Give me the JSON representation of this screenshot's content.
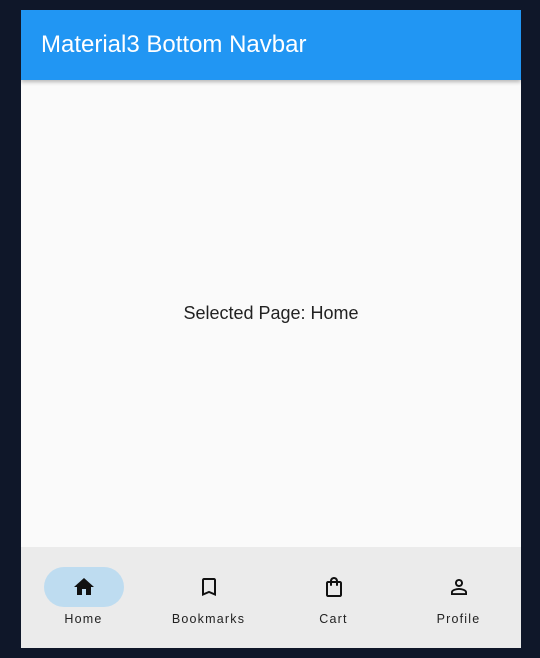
{
  "app_bar": {
    "title": "Material3 Bottom Navbar",
    "color": "#2196f3"
  },
  "body": {
    "selected_page_text": "Selected Page: Home"
  },
  "bottom_nav": {
    "selected_index": 0,
    "indicator_color": "#bedcf0",
    "items": [
      {
        "label": "Home",
        "icon": "home-icon",
        "selected": true
      },
      {
        "label": "Bookmarks",
        "icon": "bookmark-icon",
        "selected": false
      },
      {
        "label": "Cart",
        "icon": "shopping-bag-icon",
        "selected": false
      },
      {
        "label": "Profile",
        "icon": "person-icon",
        "selected": false
      }
    ]
  }
}
